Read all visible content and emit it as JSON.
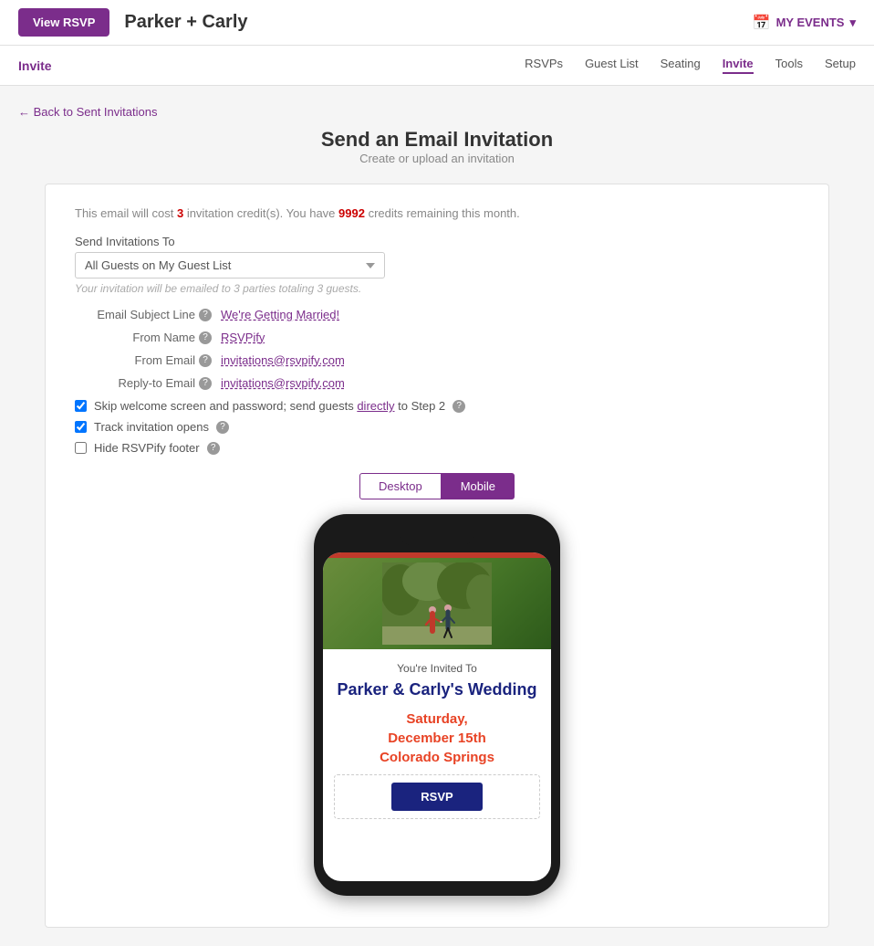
{
  "header": {
    "view_rsvp_label": "View RSVP",
    "event_title": "Parker + Carly",
    "my_events_label": "MY EVENTS"
  },
  "nav": {
    "section_label": "Invite",
    "links": [
      {
        "label": "RSVPs",
        "active": false
      },
      {
        "label": "Guest List",
        "active": false
      },
      {
        "label": "Seating",
        "active": false
      },
      {
        "label": "Invite",
        "active": true
      },
      {
        "label": "Tools",
        "active": false
      },
      {
        "label": "Setup",
        "active": false
      }
    ]
  },
  "page": {
    "back_label": "← Back to Sent Invitations",
    "title": "Send an Email Invitation",
    "subtitle": "Create or upload an invitation"
  },
  "form": {
    "info_cost": "This email will cost ",
    "info_credits_count": "3",
    "info_credits_label": " invitation credit(s). You have ",
    "info_remaining": "9992",
    "info_remaining_label": " credits remaining this month.",
    "send_invitations_label": "Send Invitations To",
    "send_select_value": "All Guests on My Guest List",
    "guest_hint": "Your invitation will be emailed to 3 parties totaling 3 guests.",
    "email_subject_label": "Email Subject Line",
    "email_subject_info": "?",
    "email_subject_value": "We're Getting Married!",
    "from_name_label": "From Name",
    "from_name_info": "?",
    "from_name_value": "RSVPify",
    "from_email_label": "From Email",
    "from_email_info": "?",
    "from_email_value": "invitations@rsvpify.com",
    "reply_to_label": "Reply-to Email",
    "reply_to_info": "?",
    "reply_to_value": "invitations@rsvpify.com",
    "checkbox1_label": "Skip welcome screen and password; send guests ",
    "checkbox1_link": "directly",
    "checkbox1_rest": " to Step 2",
    "checkbox1_info": "?",
    "checkbox1_checked": true,
    "checkbox2_label": "Track invitation opens",
    "checkbox2_info": "?",
    "checkbox2_checked": true,
    "checkbox3_label": "Hide RSVPify footer",
    "checkbox3_info": "?",
    "checkbox3_checked": false
  },
  "preview": {
    "desktop_label": "Desktop",
    "mobile_label": "Mobile",
    "active": "Mobile"
  },
  "invite_preview": {
    "you_invited": "You're Invited To",
    "names": "Parker & Carly's Wedding",
    "date_line1": "Saturday,",
    "date_line2": "December 15th",
    "date_line3": "Colorado Springs",
    "rsvp_button": "RSVP"
  }
}
